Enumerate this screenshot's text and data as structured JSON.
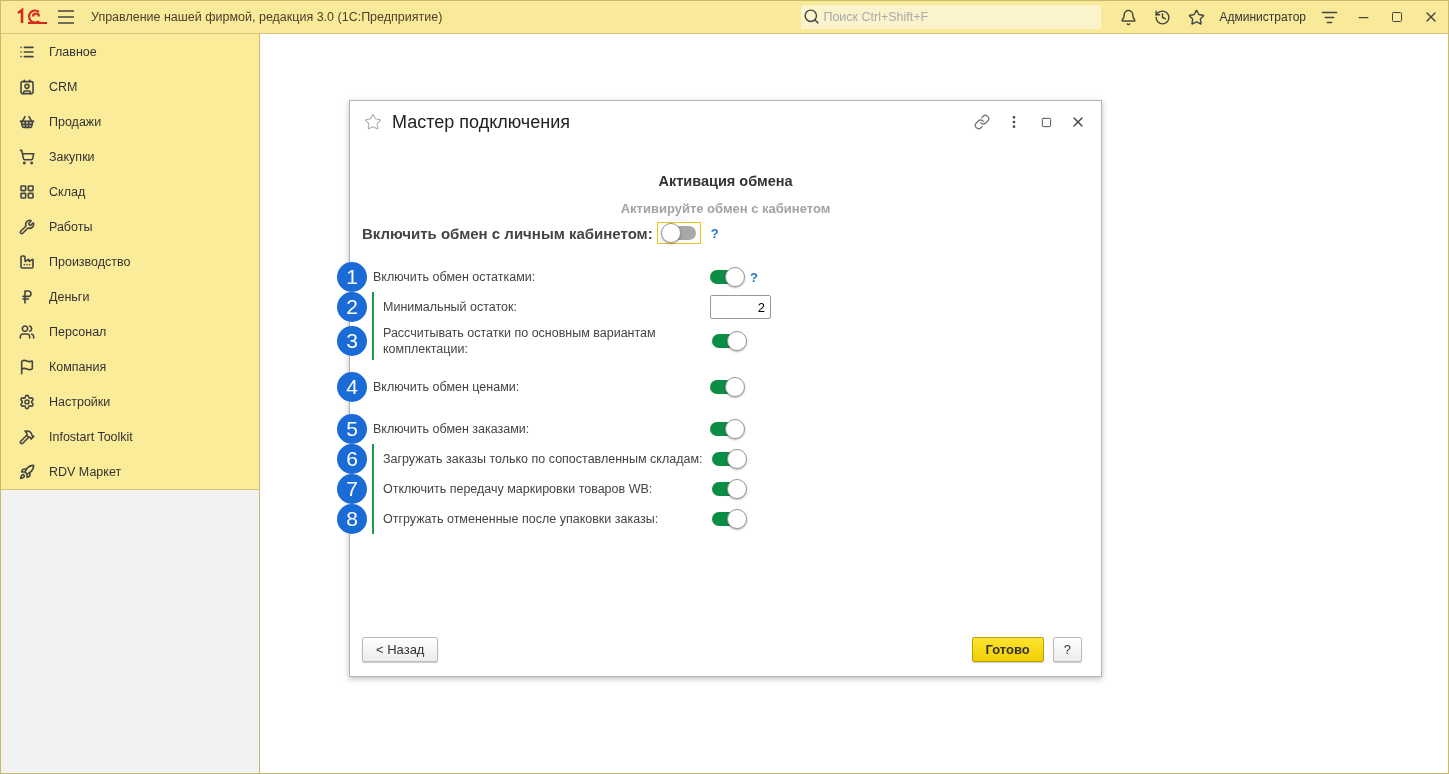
{
  "app_bar": {
    "title": "Управление нашей фирмой, редакция 3.0  (1С:Предприятие)",
    "search": {
      "placeholder": "Поиск Ctrl+Shift+F"
    },
    "user": "Администратор"
  },
  "sidebar": {
    "items": [
      {
        "label": "Главное"
      },
      {
        "label": "CRM"
      },
      {
        "label": "Продажи"
      },
      {
        "label": "Закупки"
      },
      {
        "label": "Склад"
      },
      {
        "label": "Работы"
      },
      {
        "label": "Производство"
      },
      {
        "label": "Деньги"
      },
      {
        "label": "Персонал"
      },
      {
        "label": "Компания"
      },
      {
        "label": "Настройки"
      },
      {
        "label": "Infostart Toolkit"
      },
      {
        "label": "RDV Маркет"
      }
    ]
  },
  "dialog": {
    "title": "Мастер подключения",
    "heading": "Активация обмена",
    "subtitle": "Активируйте обмен с кабинетом",
    "main_toggle": {
      "label": "Включить обмен с личным кабинетом:",
      "on": false,
      "help": "?"
    },
    "settings": [
      {
        "badge": "1",
        "label": "Включить обмен остатками:",
        "kind": "toggle",
        "on": true,
        "help": "?",
        "children": [
          {
            "badge": "2",
            "label": "Минимальный остаток:",
            "kind": "number",
            "value": "2"
          },
          {
            "badge": "3",
            "label": "Рассчитывать остатки по основным вариантам комплектации:",
            "kind": "toggle",
            "on": true
          }
        ]
      },
      {
        "badge": "4",
        "label": "Включить обмен ценами:",
        "kind": "toggle",
        "on": true
      },
      {
        "badge": "5",
        "label": "Включить обмен заказами:",
        "kind": "toggle",
        "on": true,
        "children": [
          {
            "badge": "6",
            "label": "Загружать заказы только по сопоставленным складам:",
            "kind": "toggle",
            "on": true
          },
          {
            "badge": "7",
            "label": "Отключить передачу маркировки товаров WB:",
            "kind": "toggle",
            "on": true
          },
          {
            "badge": "8",
            "label": "Отгружать отмененные после упаковки заказы:",
            "kind": "toggle",
            "on": true
          }
        ]
      }
    ],
    "buttons": {
      "back": "< Назад",
      "done": "Готово",
      "help": "?"
    }
  }
}
